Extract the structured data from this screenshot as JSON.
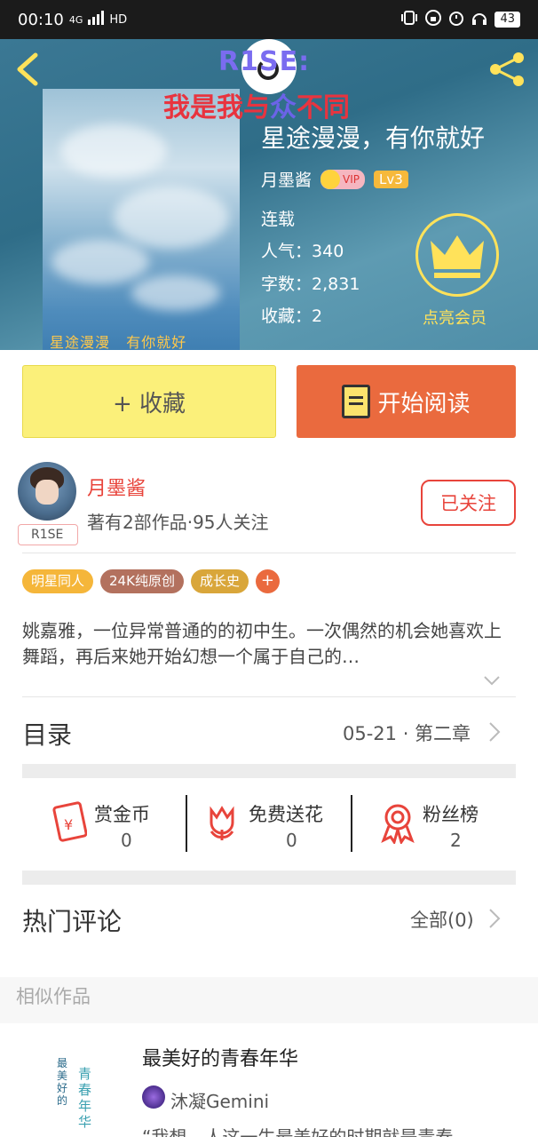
{
  "status_bar": {
    "time": "00:10",
    "network": "4G",
    "hd": "HD",
    "battery": "43"
  },
  "hero": {
    "watermark_line1": "R1SE:",
    "watermark_line2_red_a": "我是我与",
    "watermark_line2_blue": "众",
    "watermark_line2_red_b": "不同",
    "book_title": "星途漫漫，有你就好",
    "author": "月墨酱",
    "vip_badge": "VIP",
    "level_badge": "Lv3",
    "status": "连载",
    "popularity_label": "人气：",
    "popularity_value": "340",
    "word_count_label": "字数：",
    "word_count_value": "2,831",
    "favorites_label": "收藏：",
    "favorites_value": "2",
    "vip_cta": "点亮会员",
    "cover_caption_a": "星途漫漫",
    "cover_caption_b": "有你就好"
  },
  "actions": {
    "collect_label": "+ 收藏",
    "read_label": "开始阅读"
  },
  "author_block": {
    "name": "月墨酱",
    "stats": "著有2部作品·95人关注",
    "tag": "R1SE",
    "follow_label": "已关注"
  },
  "tags": [
    {
      "label": "明星同人",
      "color": "#f5b63a"
    },
    {
      "label": "24K纯原创",
      "color": "#b3715e"
    },
    {
      "label": "成长史",
      "color": "#d9a63a"
    }
  ],
  "tag_more": "+",
  "synopsis": "姚嘉雅，一位异常普通的的初中生。一次偶然的机会她喜欢上舞蹈，再后来她开始幻想一个属于自己的…",
  "catalog": {
    "title": "目录",
    "latest": "05-21 · 第二章"
  },
  "support": {
    "reward_label": "赏金币",
    "reward_value": "0",
    "flower_label": "免费送花",
    "flower_value": "0",
    "fans_label": "粉丝榜",
    "fans_value": "2"
  },
  "comments": {
    "title": "热门评论",
    "all_label": "全部(0)"
  },
  "similar": {
    "section_label": "相似作品",
    "title": "最美好的青春年华",
    "author": "沐凝Gemini",
    "quote": "“我想，人这一生最美好的时期就是青春",
    "cover_text1": "最美好的",
    "cover_text2": "青春年华"
  },
  "colors": {
    "accent_red": "#e8443b",
    "read_button": "#ea6a3e",
    "collect_button": "#fbf07a",
    "vip_gold": "#ffe25a"
  }
}
